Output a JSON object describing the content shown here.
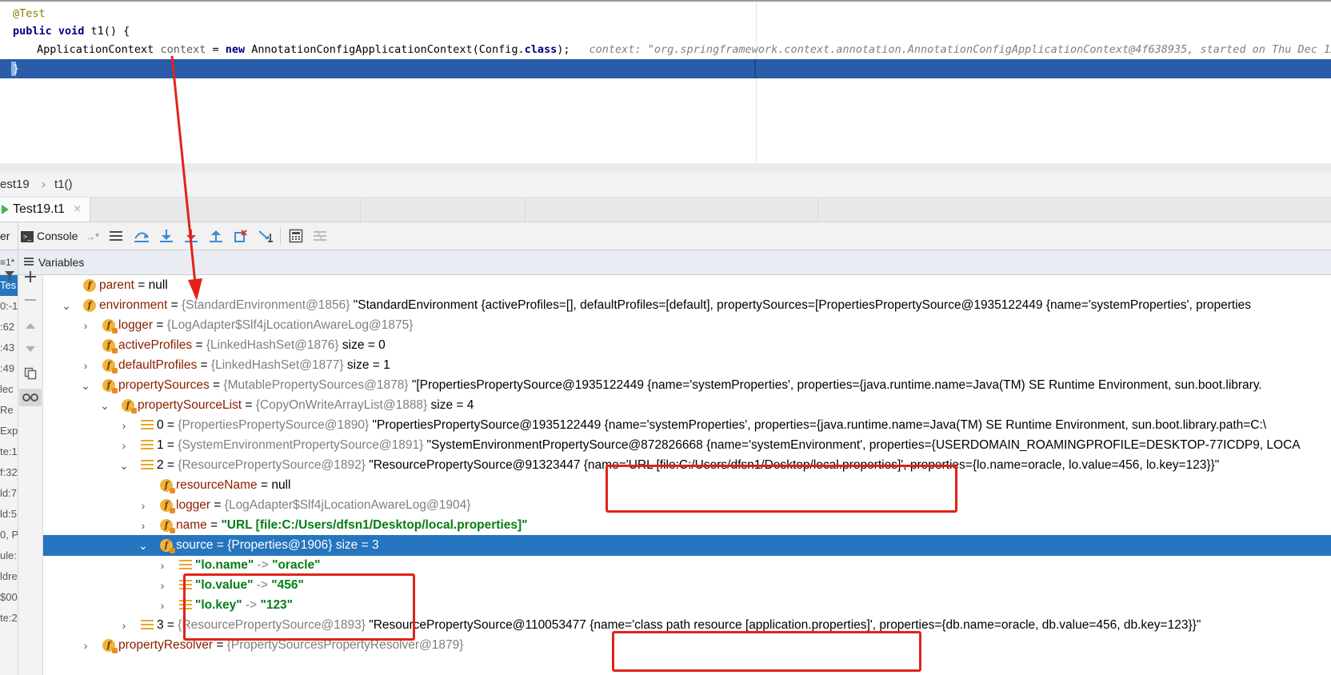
{
  "editor": {
    "line1": "@Test",
    "line2_kw": "public void",
    "line2_rest": " t1() {",
    "line3_type": "ApplicationContext",
    "line3_var": "context",
    "line3_eq": " = ",
    "line3_new": "new",
    "line3_ctor": " AnnotationConfigApplicationContext(Config.",
    "line3_class": "class",
    "line3_end": ");",
    "inline_value": "context: \"org.springframework.context.annotation.AnnotationConfigApplicationContext@4f638935, started on Thu Dec 12 14",
    "line4": "}"
  },
  "breadcrumb": {
    "item1": "est19",
    "sep": "›",
    "item2": "t1()"
  },
  "tabs": {
    "run_tab": "Test19.t1",
    "close": "×"
  },
  "toolbar": {
    "left_cut": "er",
    "console": "Console",
    "console_arrow": "→*"
  },
  "vars_header": {
    "left_cut": "≡1*",
    "title": "Variables"
  },
  "frames_strip": [
    "Tes",
    "0:-1",
    ":62",
    ":43",
    ":49",
    "lec",
    "Re",
    "Exp",
    "te:1",
    "f:32",
    "ld:7",
    "ld:5",
    "0, P",
    "ule:",
    "ldre",
    "$00",
    "te:2"
  ],
  "tree": {
    "parent": {
      "name": "parent",
      "val": " = null"
    },
    "environment": {
      "name": "environment",
      "eq": " = ",
      "ref": "{StandardEnvironment@1856}",
      "val": " \"StandardEnvironment {activeProfiles=[], defaultProfiles=[default], propertySources=[PropertiesPropertySource@1935122449 {name='systemProperties', properties"
    },
    "logger": {
      "name": "logger",
      "eq": " = ",
      "ref": "{LogAdapter$Slf4jLocationAwareLog@1875}"
    },
    "activeProfiles": {
      "name": "activeProfiles",
      "eq": " = ",
      "ref": "{LinkedHashSet@1876}",
      "val": "  size = 0"
    },
    "defaultProfiles": {
      "name": "defaultProfiles",
      "eq": " = ",
      "ref": "{LinkedHashSet@1877}",
      "val": "  size = 1"
    },
    "propertySources": {
      "name": "propertySources",
      "eq": " = ",
      "ref": "{MutablePropertySources@1878}",
      "val": " \"[PropertiesPropertySource@1935122449 {name='systemProperties', properties={java.runtime.name=Java(TM) SE Runtime Environment, sun.boot.library."
    },
    "propertySourceList": {
      "name": "propertySourceList",
      "eq": " = ",
      "ref": "{CopyOnWriteArrayList@1888}",
      "val": "  size = 4"
    },
    "item0": {
      "idx": "0",
      "eq": " = ",
      "ref": "{PropertiesPropertySource@1890}",
      "val": " \"PropertiesPropertySource@1935122449 {name='systemProperties', properties={java.runtime.name=Java(TM) SE Runtime Environment, sun.boot.library.path=C:\\"
    },
    "item1": {
      "idx": "1",
      "eq": " = ",
      "ref": "{SystemEnvironmentPropertySource@1891}",
      "val": " \"SystemEnvironmentPropertySource@872826668 {name='systemEnvironment', properties={USERDOMAIN_ROAMINGPROFILE=DESKTOP-77ICDP9, LOCA"
    },
    "item2": {
      "idx": "2",
      "eq": " = ",
      "ref": "{ResourcePropertySource@1892}",
      "val": " \"ResourcePropertySource@91323447 {name='URL [file:C:/Users/dfsn1/Desktop/local.properties]', properties={lo.name=oracle, lo.value=456, lo.key=123}}\""
    },
    "resourceName": {
      "name": "resourceName",
      "val": " = null"
    },
    "logger2": {
      "name": "logger",
      "eq": " = ",
      "ref": "{LogAdapter$Slf4jLocationAwareLog@1904}"
    },
    "name": {
      "name": "name",
      "eq": " = ",
      "val": "\"URL [file:C:/Users/dfsn1/Desktop/local.properties]\""
    },
    "source": {
      "name": "source",
      "eq": " = ",
      "ref": "{Properties@1906}",
      "val": "  size = 3"
    },
    "entries": [
      {
        "key": "\"lo.name\"",
        "arrow": " -> ",
        "value": "\"oracle\""
      },
      {
        "key": "\"lo.value\"",
        "arrow": " -> ",
        "value": "\"456\""
      },
      {
        "key": "\"lo.key\"",
        "arrow": " -> ",
        "value": "\"123\""
      }
    ],
    "item3": {
      "idx": "3",
      "eq": " = ",
      "ref": "{ResourcePropertySource@1893}",
      "val": " \"ResourcePropertySource@110053477 {name='class path resource [application.properties]', properties={db.name=oracle, db.value=456, db.key=123}}\""
    },
    "propertyResolver": {
      "name": "propertyResolver",
      "eq": " = ",
      "ref": "{PropertySourcesPropertyResolver@1879}"
    }
  },
  "colors": {
    "annotation_red": "#e2231a",
    "selection_blue": "#2675bf",
    "caret_line": "#2a5ca8"
  },
  "icons": [
    "field-icon",
    "list-item-icon",
    "expand-chevron-icon",
    "collapse-chevron-icon"
  ]
}
